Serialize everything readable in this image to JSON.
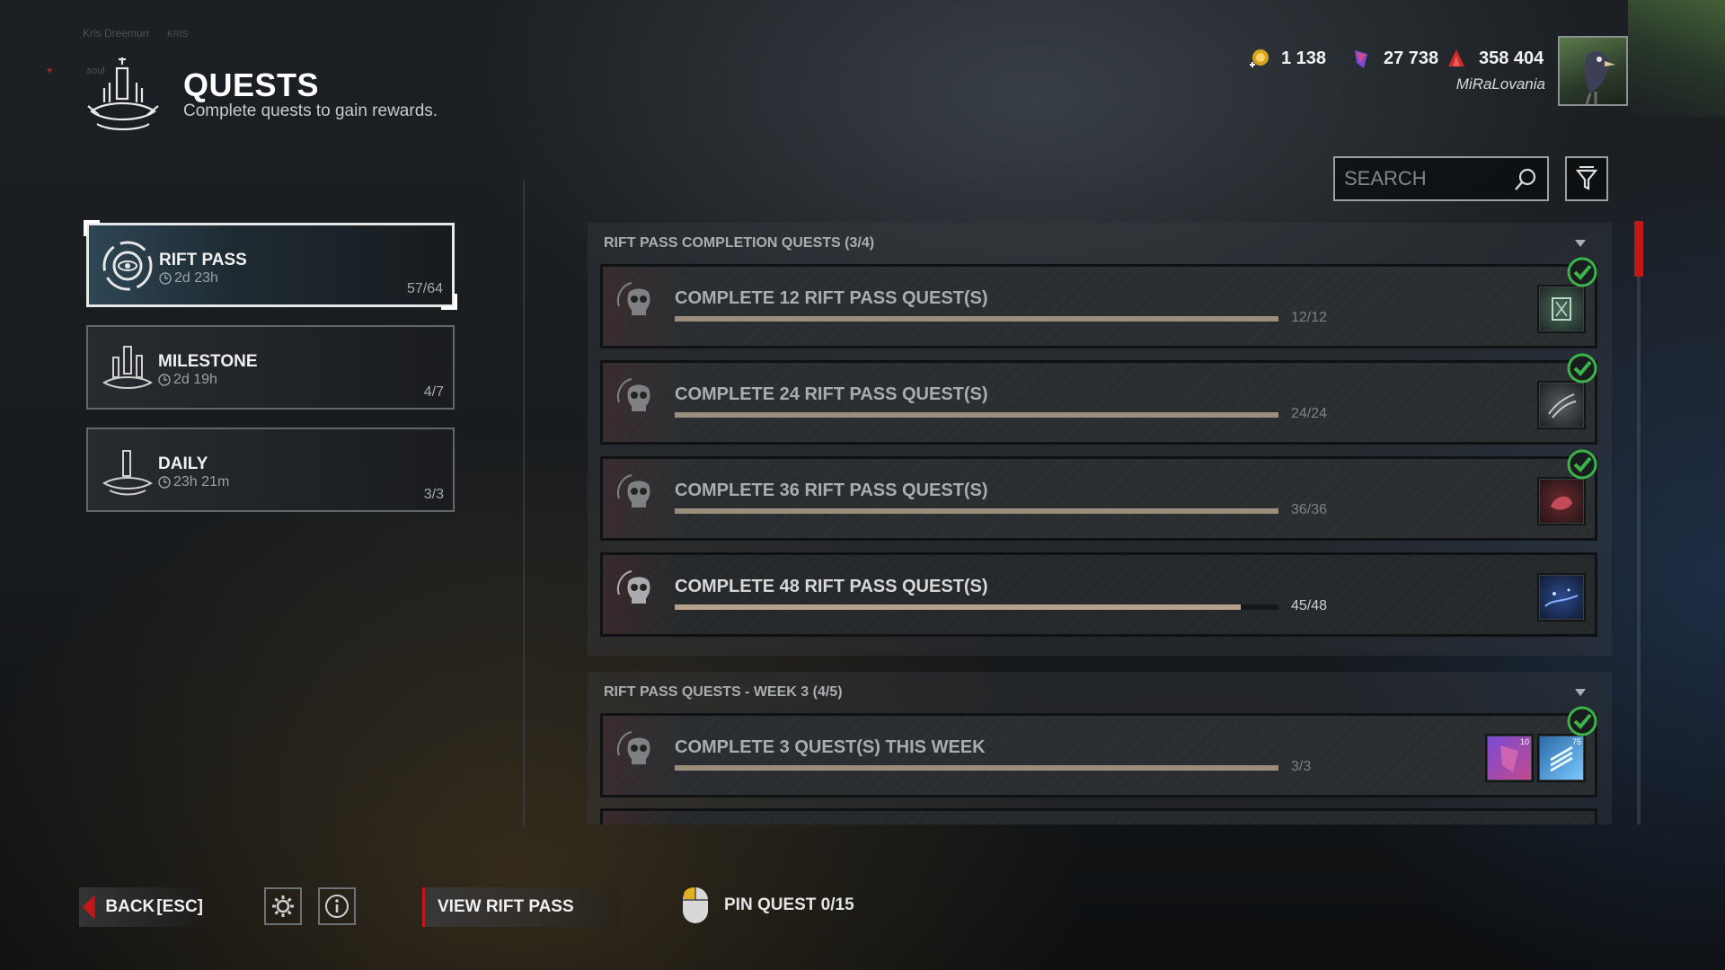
{
  "user_hint": {
    "name": "Kris Dreemurr",
    "tag": "KRIS",
    "status": "soul"
  },
  "header": {
    "title": "QUESTS",
    "subtitle": "Complete quests to gain rewards."
  },
  "currencies": [
    {
      "icon": "bloodpoints-icon",
      "value": "1 138"
    },
    {
      "icon": "auric-cells-icon",
      "value": "27 738"
    },
    {
      "icon": "iridescent-shards-icon",
      "value": "358 404"
    }
  ],
  "player": {
    "name": "MiRaLovania"
  },
  "search": {
    "placeholder": "SEARCH"
  },
  "categories": [
    {
      "name": "RIFT PASS",
      "timer": "2d 23h",
      "count": "57/64",
      "selected": true
    },
    {
      "name": "MILESTONE",
      "timer": "2d 19h",
      "count": "4/7",
      "selected": false
    },
    {
      "name": "DAILY",
      "timer": "23h 21m",
      "count": "3/3",
      "selected": false
    }
  ],
  "sections": [
    {
      "title": "RIFT PASS COMPLETION QUESTS (3/4)",
      "quests": [
        {
          "title": "COMPLETE 12 RIFT PASS QUEST(S)",
          "progress": "12/12",
          "fraction": 1.0,
          "done": true
        },
        {
          "title": "COMPLETE 24 RIFT PASS QUEST(S)",
          "progress": "24/24",
          "fraction": 1.0,
          "done": true
        },
        {
          "title": "COMPLETE 36 RIFT PASS QUEST(S)",
          "progress": "36/36",
          "fraction": 1.0,
          "done": true
        },
        {
          "title": "COMPLETE 48 RIFT PASS QUEST(S)",
          "progress": "45/48",
          "fraction": 0.9375,
          "done": false
        }
      ]
    },
    {
      "title": "RIFT PASS QUESTS - WEEK 3 (4/5)",
      "quests": [
        {
          "title": "COMPLETE 3 QUEST(S) THIS WEEK",
          "progress": "3/3",
          "fraction": 1.0,
          "done": true,
          "reward_counts": [
            "10",
            "75"
          ]
        }
      ]
    }
  ],
  "footer": {
    "back_label": "BACK",
    "back_key": "[ESC]",
    "view_rift_pass": "VIEW RIFT PASS",
    "pin_quest": "PIN QUEST 0/15"
  },
  "colors": {
    "accent_red": "#c21818",
    "check_green": "#3cb44a",
    "progress_fill": "#b4a189"
  }
}
